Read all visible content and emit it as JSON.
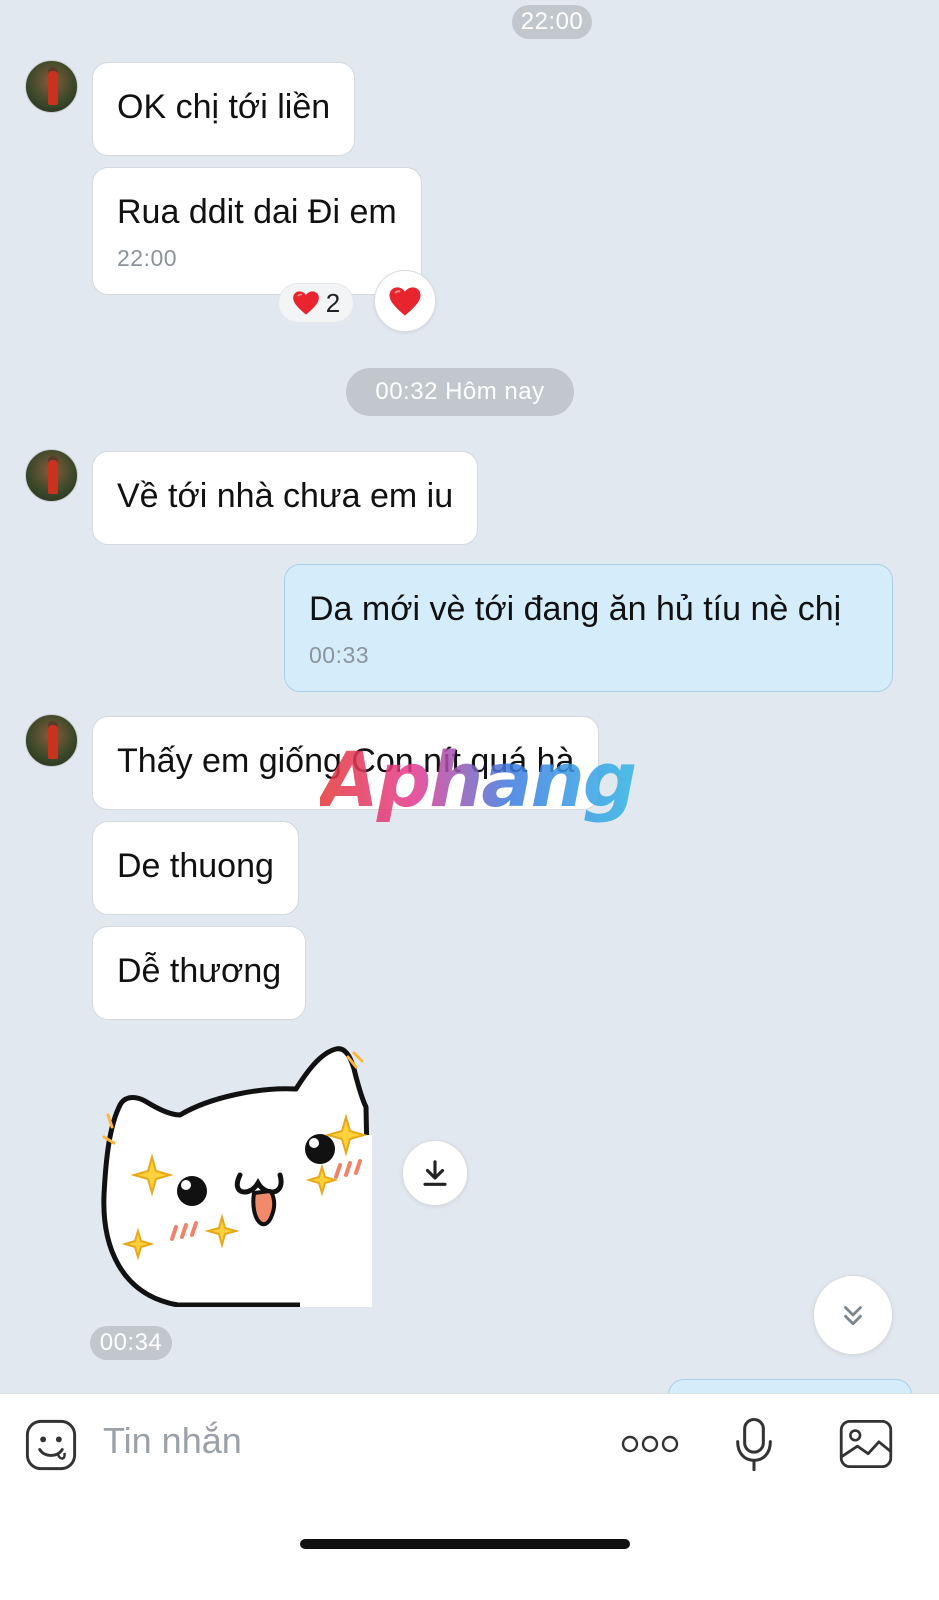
{
  "chat": {
    "timestamp_top": "22:00",
    "timestamp_mid": "00:32 Hôm nay",
    "messages": {
      "m1": "OK chị tới liền",
      "m2_text": "Rua ddit dai Đi em",
      "m2_time": "22:00",
      "m3": "Về tới nhà chưa em iu",
      "m4_text": "Da mới vè tới đang ăn hủ tíu nè chị",
      "m4_time": "00:33",
      "m5": "Thấy em giống Con nít quá hà",
      "m6": "De thuong",
      "m7": "Dễ thương",
      "sticker_time": "00:34"
    },
    "reaction": {
      "emoji": "❤️",
      "count": "2"
    },
    "watermark": "Aphang"
  },
  "composer": {
    "placeholder": "Tin nhắn"
  },
  "icons": {
    "emoji": "smiley-icon",
    "more": "more-dots-icon",
    "mic": "microphone-icon",
    "image": "image-icon",
    "download": "download-icon",
    "scroll_down": "double-chevron-down-icon",
    "heart": "heart-icon"
  },
  "colors": {
    "background": "#e2e8f0",
    "incoming_bubble": "#ffffff",
    "outgoing_bubble": "#d5ecfa",
    "timestamp_pill": "#c2c7cd",
    "heart": "#e8242f"
  }
}
